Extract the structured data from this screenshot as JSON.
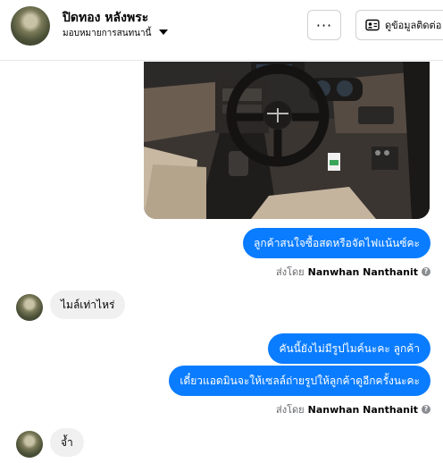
{
  "header": {
    "name": "ปิดทอง หลังพระ",
    "subtitle": "มอบหมายการสนทนานี้",
    "more_label": "···",
    "contact_label": "ดูข้อมูลติดต่อ"
  },
  "messages": {
    "msg1": "ลูกค้าสนใจซื้อสดหรือจัดไฟแน้นซ์คะ",
    "sent_by_1_prefix": "ส่งโดย",
    "sent_by_1_name": "Nanwhan Nanthanit",
    "msg2": "ไมล์เท่าไหร่",
    "msg3": "คันนี้ยังไม่มีรูปไมค์นะคะ ลูกค้า",
    "msg4": "เดี๋ยวแอดมินจะให้เซลล์ถ่ายรูปให้ลูกค้าดูอีกครั้งนะคะ",
    "sent_by_2_prefix": "ส่งโดย",
    "sent_by_2_name": "Nanwhan Nanthanit",
    "msg5": "จ้ำ"
  },
  "colors": {
    "outgoing": "#0a7cff",
    "incoming": "#f0f0f0"
  }
}
